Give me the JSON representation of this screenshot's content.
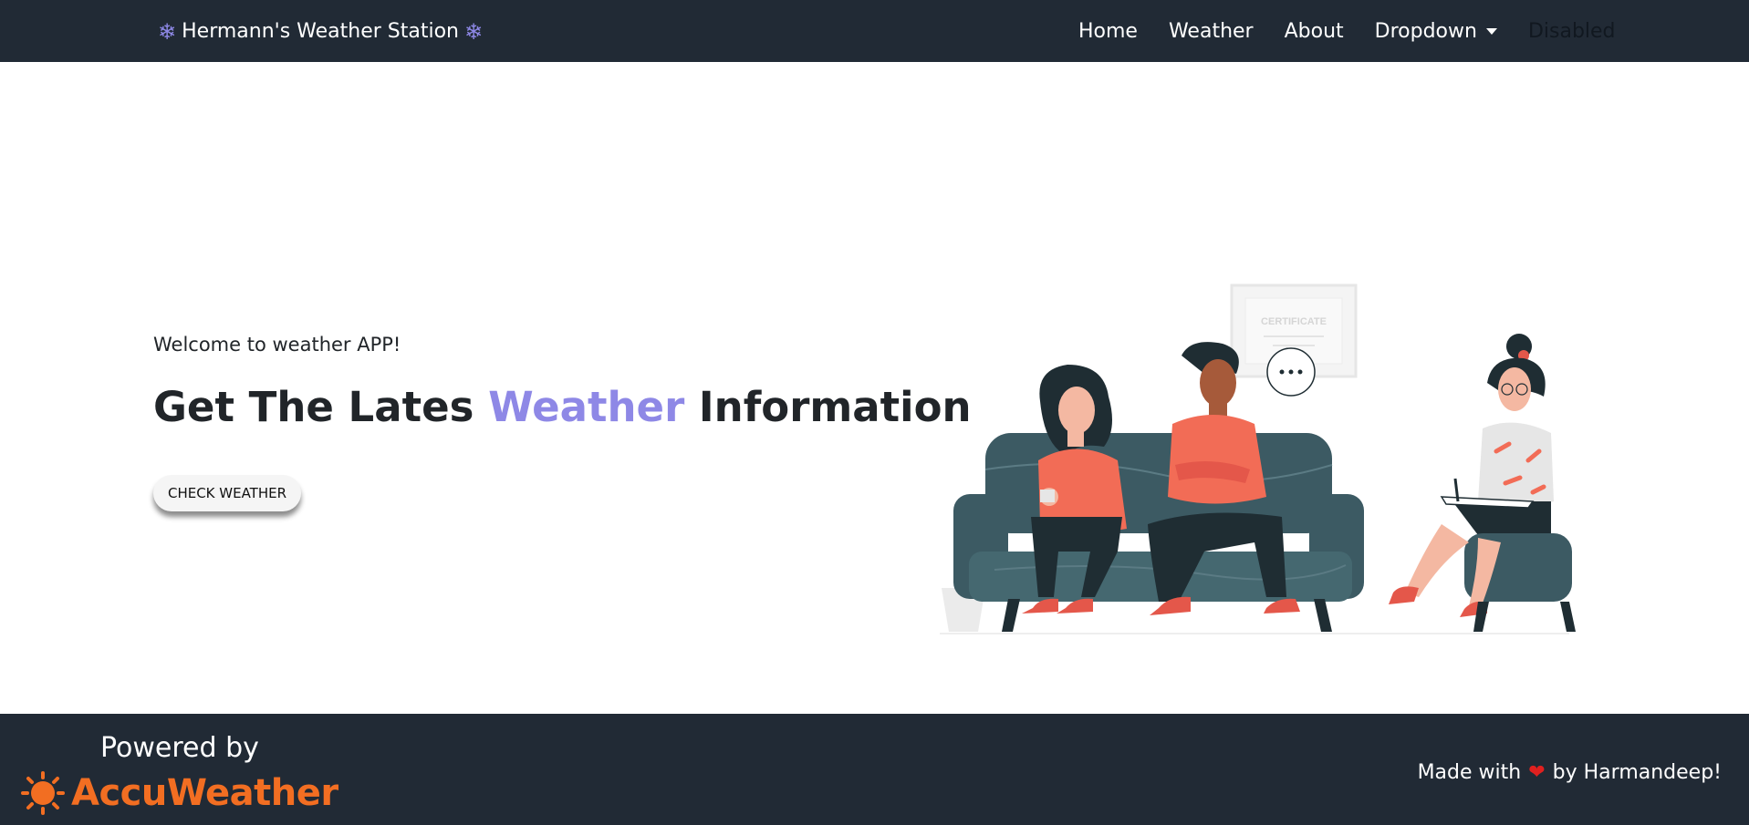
{
  "navbar": {
    "brand": "Hermann's Weather Station",
    "snow_icon": "❄",
    "links": [
      "Home",
      "Weather",
      "About",
      "Dropdown"
    ],
    "disabled": "Disabled"
  },
  "hero": {
    "welcome": "Welcome to weather APP!",
    "headline_pre": "Get The Lates ",
    "headline_accent": "Weather",
    "headline_post": " Information",
    "button": "CHECK WEATHER",
    "illustration_icon": "therapy-session-illustration",
    "certificate_text": "CERTIFICATE",
    "accent_color": "#8e88e6"
  },
  "footer": {
    "powered": "Powered by",
    "brand": "AccuWeather",
    "brand_color": "#f26e22",
    "made_pre": "Made with",
    "heart": "❤",
    "made_post": "by Harmandeep!"
  }
}
